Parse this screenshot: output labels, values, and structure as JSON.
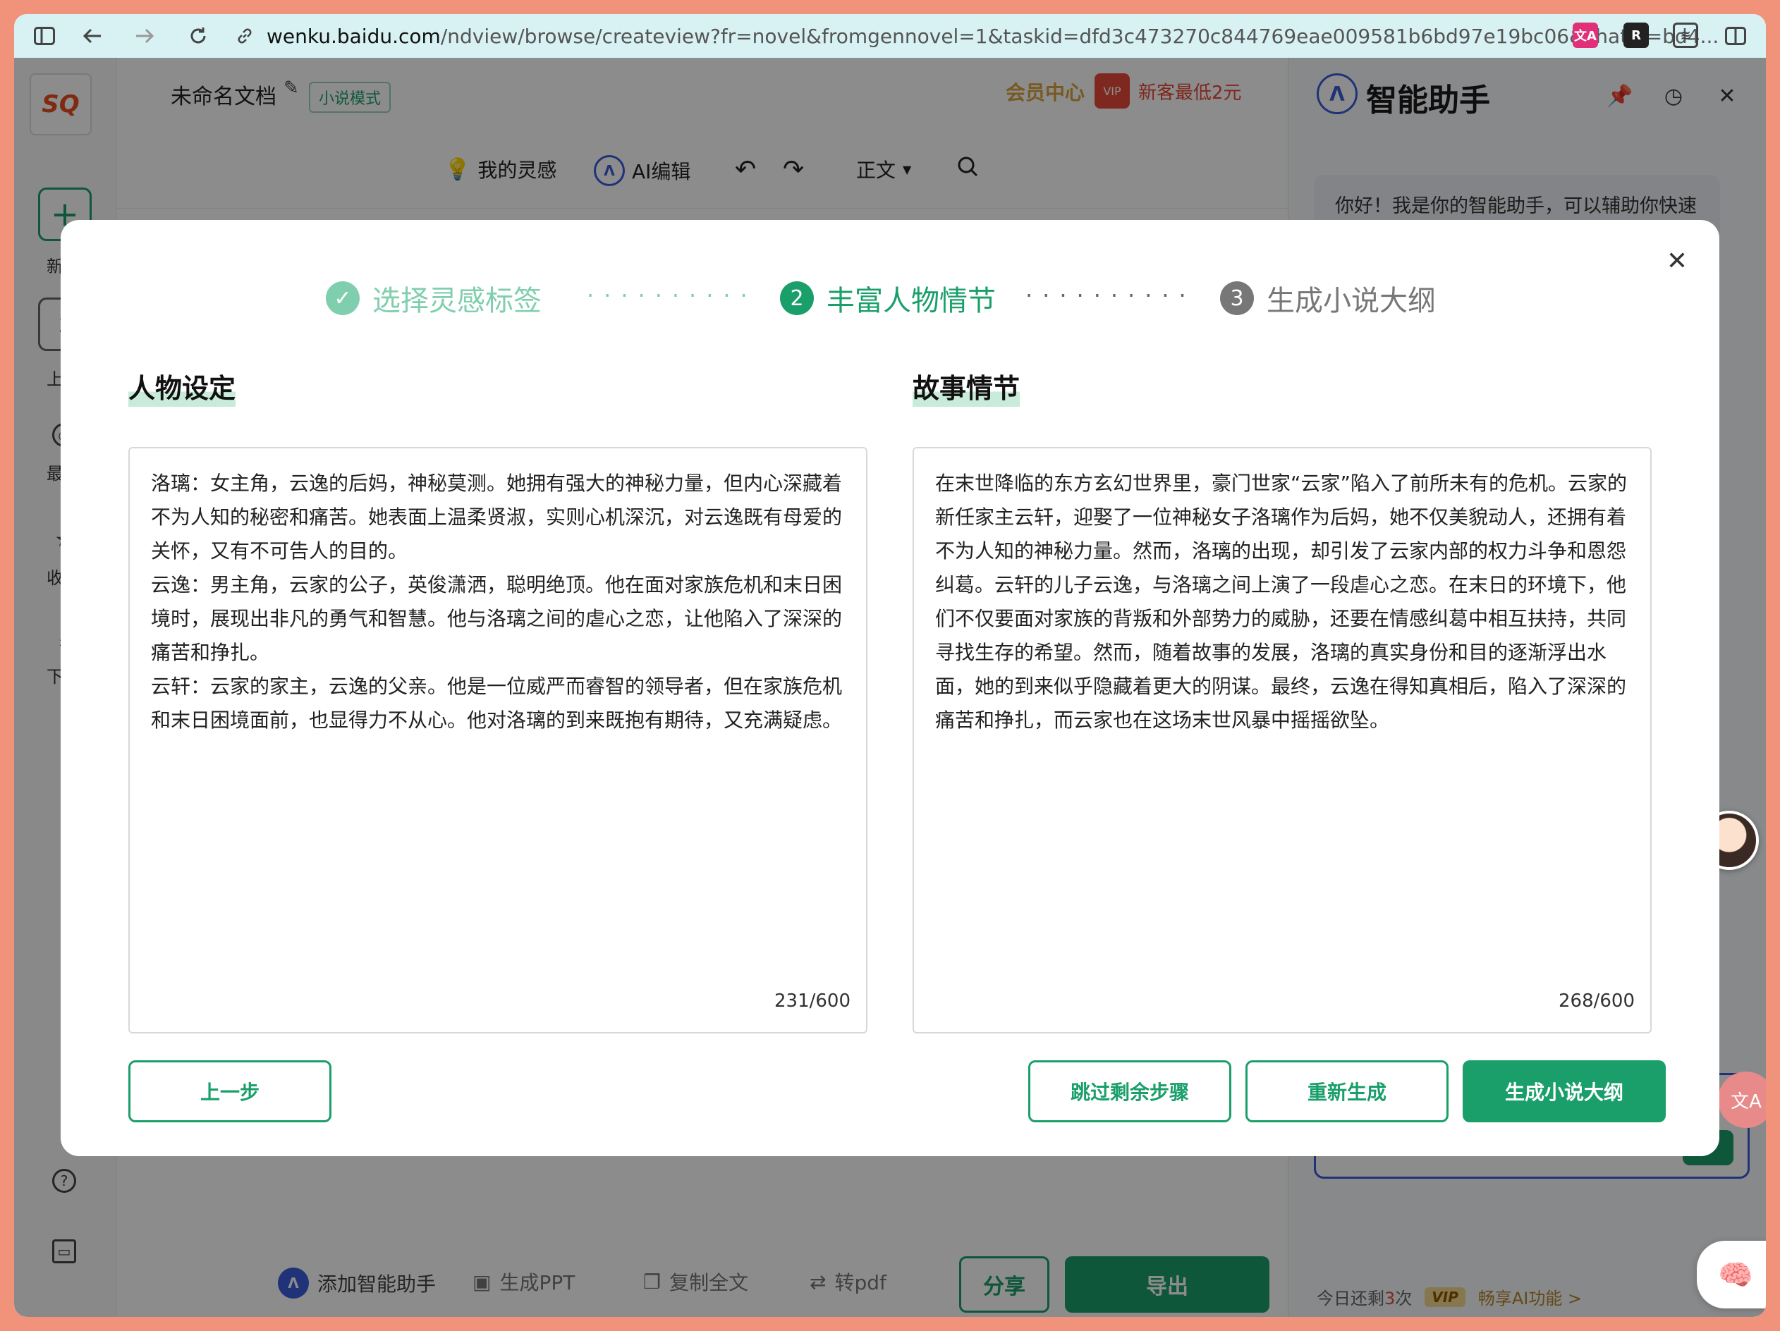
{
  "browser": {
    "url_host": "wenku.baidu.com",
    "url_path": "/ndview/browse/createview?fr=novel&fromgennovel=1&taskid=dfd3c473270c844769eae009581b6bd97e19bc06&chatid=bd4..."
  },
  "editor": {
    "doc_title": "未命名文档",
    "mode_badge": "小说模式",
    "member_center": "会员中心",
    "vip_promo": "新客最低2元",
    "toolbar": {
      "inspiration": "我的灵感",
      "ai_edit": "AI编辑",
      "style": "正文"
    },
    "rail": [
      "新",
      "上",
      "最",
      "收",
      "下"
    ],
    "bottom": {
      "add_assistant": "添加智能助手",
      "gen_ppt": "生成PPT",
      "copy_all": "复制全文",
      "to_pdf": "转pdf",
      "share": "分享",
      "export": "导出"
    }
  },
  "assistant": {
    "title": "智能助手",
    "greeting": "你好！我是你的智能助手，可以辅助你快速写作",
    "remaining_prefix": "今日还剩",
    "remaining_count": "3",
    "remaining_suffix": "次",
    "vip_tag": "VIP",
    "vip_text": "畅享AI功能 >"
  },
  "modal": {
    "steps": [
      {
        "index": "✓",
        "label": "选择灵感标签",
        "state": "done"
      },
      {
        "index": "2",
        "label": "丰富人物情节",
        "state": "active"
      },
      {
        "index": "3",
        "label": "生成小说大纲",
        "state": "pending"
      }
    ],
    "characters": {
      "title": "人物设定",
      "paragraphs": [
        "洛璃：女主角，云逸的后妈，神秘莫测。她拥有强大的神秘力量，但内心深藏着不为人知的秘密和痛苦。她表面上温柔贤淑，实则心机深沉，对云逸既有母爱的关怀，又有不可告人的目的。",
        "云逸：男主角，云家的公子，英俊潇洒，聪明绝顶。他在面对家族危机和末日困境时，展现出非凡的勇气和智慧。他与洛璃之间的虐心之恋，让他陷入了深深的痛苦和挣扎。",
        "云轩：云家的家主，云逸的父亲。他是一位威严而睿智的领导者，但在家族危机和末日困境面前，也显得力不从心。他对洛璃的到来既抱有期待，又充满疑虑。"
      ],
      "counter": "231/600"
    },
    "plot": {
      "title": "故事情节",
      "text": "在末世降临的东方玄幻世界里，豪门世家“云家”陷入了前所未有的危机。云家的新任家主云轩，迎娶了一位神秘女子洛璃作为后妈，她不仅美貌动人，还拥有着不为人知的神秘力量。然而，洛璃的出现，却引发了云家内部的权力斗争和恩怨纠葛。云轩的儿子云逸，与洛璃之间上演了一段虐心之恋。在末日的环境下，他们不仅要面对家族的背叛和外部势力的威胁，还要在情感纠葛中相互扶持，共同寻找生存的希望。然而，随着故事的发展，洛璃的真实身份和目的逐渐浮出水面，她的到来似乎隐藏着更大的阴谋。最终，云逸在得知真相后，陷入了深深的痛苦和挣扎，而云家也在这场末世风暴中摇摇欲坠。",
      "counter": "268/600"
    },
    "buttons": {
      "prev": "上一步",
      "skip": "跳过剩余步骤",
      "regenerate": "重新生成",
      "generate": "生成小说大纲"
    }
  },
  "colors": {
    "accent": "#1a9f6b",
    "accent_light": "#7fcfae",
    "pending": "#777777"
  }
}
